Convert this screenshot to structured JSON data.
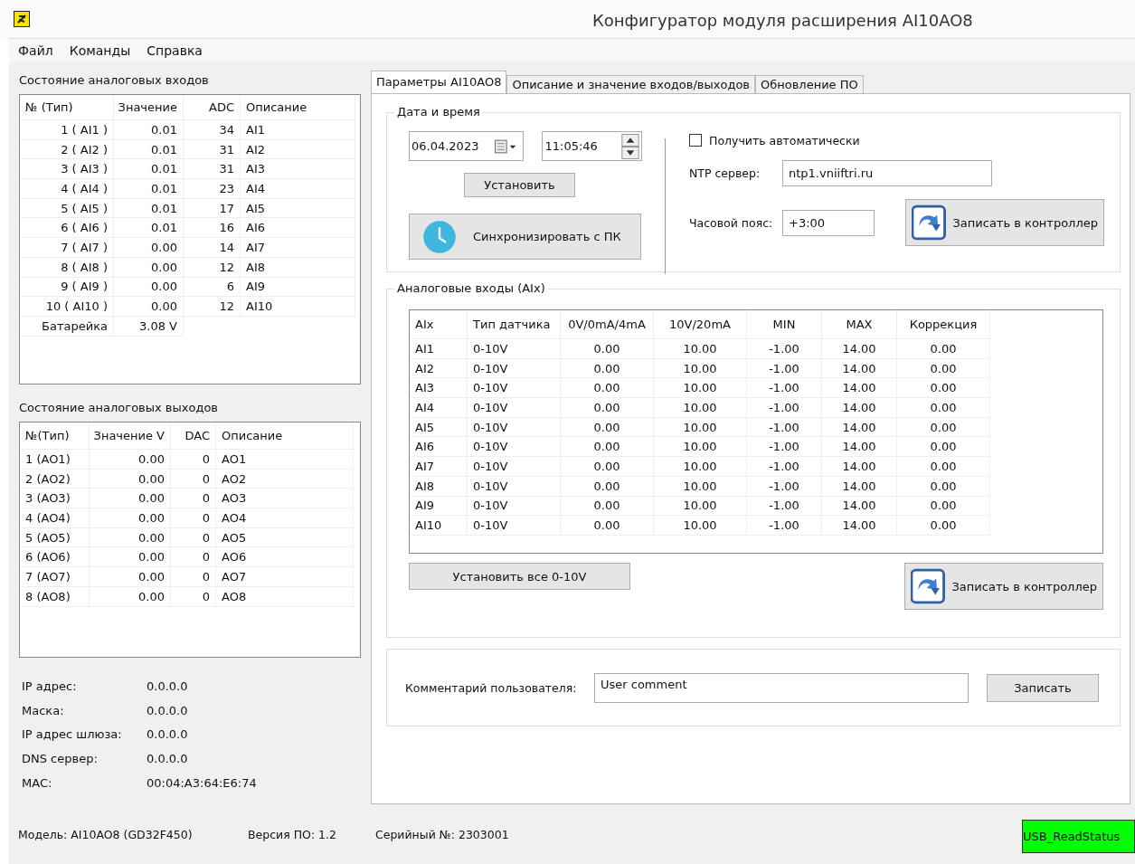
{
  "window": {
    "title": "Конфигуратор модуля расширения AI10AO8"
  },
  "menu": [
    "Файл",
    "Команды",
    "Справка"
  ],
  "inputs_panel": {
    "title": "Состояние аналоговых входов",
    "columns": [
      "№ (Тип)",
      "Значение",
      "ADC",
      "Описание"
    ],
    "rows": [
      [
        "1 ( AI1 )",
        "0.01",
        "34",
        "AI1"
      ],
      [
        "2 ( AI2 )",
        "0.01",
        "31",
        "AI2"
      ],
      [
        "3 ( AI3 )",
        "0.01",
        "31",
        "AI3"
      ],
      [
        "4 ( AI4 )",
        "0.01",
        "23",
        "AI4"
      ],
      [
        "5 ( AI5 )",
        "0.01",
        "17",
        "AI5"
      ],
      [
        "6 ( AI6 )",
        "0.01",
        "16",
        "AI6"
      ],
      [
        "7 ( AI7 )",
        "0.00",
        "14",
        "AI7"
      ],
      [
        "8 ( AI8 )",
        "0.00",
        "12",
        "AI8"
      ],
      [
        "9 ( AI9 )",
        "0.00",
        "6",
        "AI9"
      ],
      [
        "10 ( AI10 )",
        "0.00",
        "12",
        "AI10"
      ],
      [
        "Батарейка",
        "3.08 V"
      ]
    ]
  },
  "outputs_panel": {
    "title": "Состояние аналоговых выходов",
    "columns": [
      "№(Тип)",
      "Значение V",
      "DAC",
      "Описание"
    ],
    "rows": [
      [
        "1 (AO1)",
        "0.00",
        "0",
        "AO1"
      ],
      [
        "2 (AO2)",
        "0.00",
        "0",
        "AO2"
      ],
      [
        "3 (AO3)",
        "0.00",
        "0",
        "AO3"
      ],
      [
        "4 (AO4)",
        "0.00",
        "0",
        "AO4"
      ],
      [
        "5 (AO5)",
        "0.00",
        "0",
        "AO5"
      ],
      [
        "6 (AO6)",
        "0.00",
        "0",
        "AO6"
      ],
      [
        "7 (AO7)",
        "0.00",
        "0",
        "AO7"
      ],
      [
        "8 (AO8)",
        "0.00",
        "0",
        "AO8"
      ]
    ]
  },
  "network": [
    {
      "label": "IP адрес:",
      "value": "0.0.0.0"
    },
    {
      "label": "Маска:",
      "value": "0.0.0.0"
    },
    {
      "label": "IP адрес шлюза:",
      "value": "0.0.0.0"
    },
    {
      "label": "DNS сервер:",
      "value": "0.0.0.0"
    },
    {
      "label": "MAC:",
      "value": "00:04:A3:64:E6:74"
    }
  ],
  "tabs": [
    {
      "label": "Параметры AI10AO8",
      "selected": true
    },
    {
      "label": "Описание и значение входов/выходов",
      "selected": false
    },
    {
      "label": "Обновление ПО",
      "selected": false
    }
  ],
  "datetime": {
    "title": "Дата и время",
    "date": "06.04.2023",
    "time": "11:05:46",
    "set_button": "Установить",
    "sync_button": "Синхронизировать с ПК",
    "auto": {
      "label": "Получить автоматически",
      "checked": false
    },
    "ntp_label": "NTP сервер:",
    "ntp_value": "ntp1.vniiftri.ru",
    "tz_label": "Часовой пояс:",
    "tz_value": "+3:00",
    "write_button": "Записать в контроллер"
  },
  "analog_inputs": {
    "title": "Аналоговые входы (AIx)",
    "columns": [
      "AIx",
      "Тип датчика",
      "0V/0mA/4mA",
      "10V/20mA",
      "MIN",
      "MAX",
      "Коррекция"
    ],
    "rows": [
      [
        "AI1",
        "0-10V",
        "0.00",
        "10.00",
        "-1.00",
        "14.00",
        "0.00"
      ],
      [
        "AI2",
        "0-10V",
        "0.00",
        "10.00",
        "-1.00",
        "14.00",
        "0.00"
      ],
      [
        "AI3",
        "0-10V",
        "0.00",
        "10.00",
        "-1.00",
        "14.00",
        "0.00"
      ],
      [
        "AI4",
        "0-10V",
        "0.00",
        "10.00",
        "-1.00",
        "14.00",
        "0.00"
      ],
      [
        "AI5",
        "0-10V",
        "0.00",
        "10.00",
        "-1.00",
        "14.00",
        "0.00"
      ],
      [
        "AI6",
        "0-10V",
        "0.00",
        "10.00",
        "-1.00",
        "14.00",
        "0.00"
      ],
      [
        "AI7",
        "0-10V",
        "0.00",
        "10.00",
        "-1.00",
        "14.00",
        "0.00"
      ],
      [
        "AI8",
        "0-10V",
        "0.00",
        "10.00",
        "-1.00",
        "14.00",
        "0.00"
      ],
      [
        "AI9",
        "0-10V",
        "0.00",
        "10.00",
        "-1.00",
        "14.00",
        "0.00"
      ],
      [
        "AI10",
        "0-10V",
        "0.00",
        "10.00",
        "-1.00",
        "14.00",
        "0.00"
      ]
    ],
    "set_all_button": "Установить все 0-10V",
    "write_button": "Записать в контроллер"
  },
  "comment": {
    "label": "Комментарий пользователя:",
    "value": "User comment",
    "button": "Записать"
  },
  "status_bar": {
    "model": "Модель: AI10AO8 (GD32F450)",
    "firmware": "Версия ПО: 1.2",
    "serial": "Серийный №: 2303001",
    "usb_status": "USB_ReadStatus"
  }
}
